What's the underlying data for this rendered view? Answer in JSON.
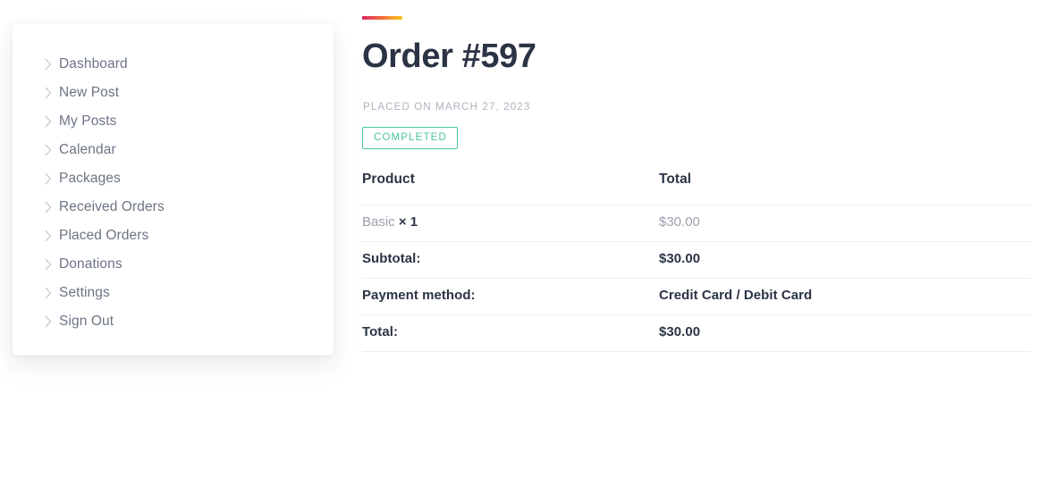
{
  "sidebar": {
    "items": [
      {
        "label": "Dashboard",
        "icon": "chevron-right-icon"
      },
      {
        "label": "New Post",
        "icon": "chevron-right-icon"
      },
      {
        "label": "My Posts",
        "icon": "chevron-right-icon"
      },
      {
        "label": "Calendar",
        "icon": "chevron-right-icon"
      },
      {
        "label": "Packages",
        "icon": "chevron-right-icon"
      },
      {
        "label": "Received Orders",
        "icon": "chevron-right-icon"
      },
      {
        "label": "Placed Orders",
        "icon": "chevron-right-icon"
      },
      {
        "label": "Donations",
        "icon": "chevron-right-icon"
      },
      {
        "label": "Settings",
        "icon": "chevron-right-icon"
      },
      {
        "label": "Sign Out",
        "icon": "chevron-right-icon"
      }
    ]
  },
  "order": {
    "title": "Order #597",
    "placed_on": "PLACED ON MARCH 27, 2023",
    "status": "COMPLETED",
    "status_color": "#49c4a0",
    "accent_gradient_from": "#e0245e",
    "accent_gradient_to": "#f7c520",
    "title_color": "#2b3445"
  },
  "table": {
    "headers": {
      "product": "Product",
      "total": "Total"
    },
    "rows": [
      {
        "label": "Basic",
        "qty": "× 1",
        "value": "$30.00",
        "style": "muted"
      },
      {
        "label": "Subtotal:",
        "qty": "",
        "value": "$30.00",
        "style": "strong"
      },
      {
        "label": "Payment method:",
        "qty": "",
        "value": "Credit Card / Debit Card",
        "style": "strong"
      },
      {
        "label": "Total:",
        "qty": "",
        "value": "$30.00",
        "style": "strong"
      }
    ]
  }
}
